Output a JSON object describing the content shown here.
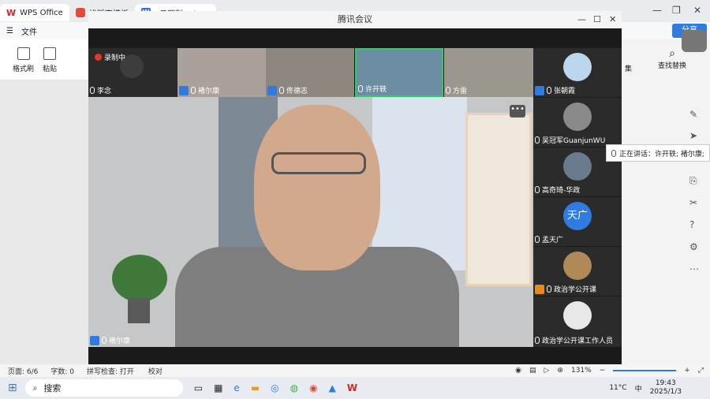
{
  "tabs": {
    "wps": "WPS Office",
    "tab2": "找稻壳模板",
    "tab3": "2日期刊1.docx"
  },
  "toolbar": {
    "file": "文件",
    "share": "分享"
  },
  "ribbon": {
    "format_painter": "格式刷",
    "paste": "粘贴",
    "find_replace": "查找替换",
    "collect": "集"
  },
  "meeting": {
    "title": "腾讯会议",
    "recording": "录制中",
    "thumbs": [
      "李念",
      "褚尔康",
      "佟德志",
      "许开轶",
      "方雷"
    ],
    "side": [
      "张朝霞",
      "吴冠军GuanjunWU",
      "高奇琦-华政",
      "孟天广",
      "政治学公开课",
      "政治学公开课工作人员"
    ],
    "avatar_text": "天广",
    "main_speaker": "褚尔康",
    "more": "•••"
  },
  "tooltip": "正在讲话：许开轶; 褚尔康;",
  "status": {
    "page": "页面: 6/6",
    "words": "字数: 0",
    "spell": "拼写检查: 打开",
    "proof": "校对",
    "zoom": "131%"
  },
  "taskbar": {
    "search": "搜索",
    "temp": "11°C",
    "time": "19:43",
    "date": "2025/1/3",
    "lang": "中"
  },
  "colors": {
    "accent": "#2f7be0",
    "record": "#e5372b",
    "active_border": "#2ecc71"
  }
}
